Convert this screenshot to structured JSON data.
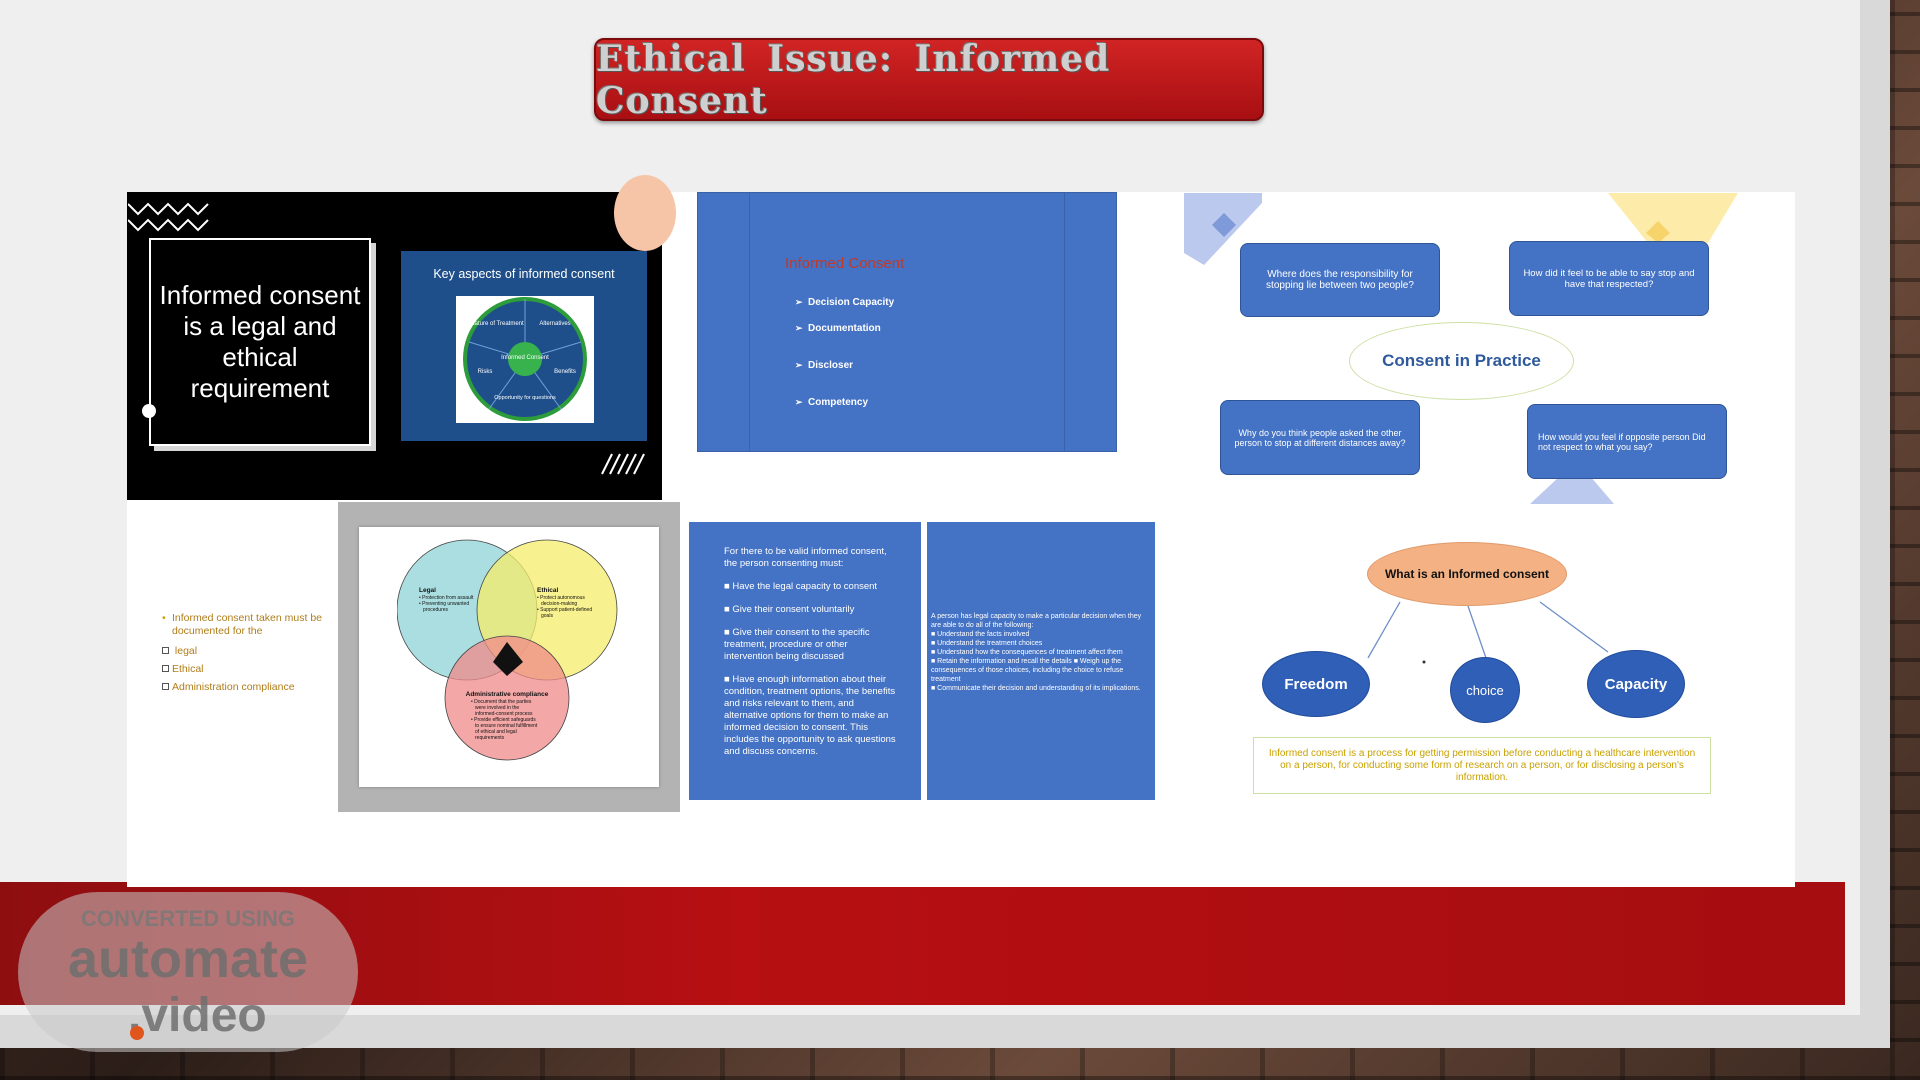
{
  "title": "Ethical Issue: Informed Consent",
  "panel_black": {
    "statement": "Informed consent is a legal and ethical requirement",
    "card_title": "Key aspects of informed consent",
    "wheel_center": "Informed Consent",
    "wheel_segments": [
      "Nature of Treatment",
      "Alternatives",
      "Benefits",
      "Opportunity for questions",
      "Risks"
    ]
  },
  "panel_blue": {
    "heading": "Informed Consent",
    "items": [
      "Decision Capacity",
      "Documentation",
      "Discloser",
      "Competency"
    ]
  },
  "bullets": {
    "lead": "Informed consent taken must be documented for the",
    "items": [
      "legal",
      "Ethical",
      "Administration compliance"
    ]
  },
  "venn": {
    "legal_title": "Legal",
    "legal_points": [
      "• Protection from assault",
      "• Preventing unwanted",
      "procedures"
    ],
    "ethical_title": "Ethical",
    "ethical_points": [
      "• Protect autonomous",
      "decision-making",
      "• Support patient-defined",
      "goals"
    ],
    "admin_title": "Administrative compliance",
    "admin_points": [
      "• Document that the parties",
      "were involved in the",
      "informed-consent process",
      "• Provide efficient safeguards",
      "to ensure nominal fulfillment",
      "of ethical and legal",
      "requirements"
    ]
  },
  "valid_consent": {
    "intro": "For there to be valid informed consent, the person consenting must:",
    "items": [
      "■ Have the legal capacity to consent",
      "■ Give their consent voluntarily",
      "■ Give their consent to the specific treatment, procedure or other intervention being discussed",
      "■ Have enough information about their condition, treatment options, the benefits and risks relevant to them, and alternative options for them to make an informed decision to consent. This includes the opportunity to ask questions and discuss concerns."
    ]
  },
  "capacity_text": {
    "intro": "A person has legal capacity to make a particular decision when they are able to do all of the following:",
    "items": [
      "■ Understand the facts involved",
      "■ Understand the treatment choices",
      "■ Understand how the consequences of treatment affect them",
      "■ Retain the information and recall the details ■ Weigh up the consequences of those choices, including the choice to refuse treatment",
      "■ Communicate their decision and understanding of its implications."
    ]
  },
  "consent_practice": {
    "center": "Consent in Practice",
    "q1": "Where does the responsibility for stopping lie between two people?",
    "q2": "How did it feel to be able to say stop and have that respected?",
    "q3": "Why do you think people asked the other person to stop at different distances away?",
    "q4": "How would you feel if opposite person Did not respect to what you say?"
  },
  "what_is": {
    "top": "What is an Informed consent",
    "nodes": [
      "Freedom",
      "choice",
      "Capacity"
    ],
    "definition": "Informed consent is a process for getting permission before conducting a healthcare intervention on a person, for conducting some form of research on a person, or for disclosing a person's information."
  },
  "watermark": {
    "line1": "CONVERTED USING",
    "line2": "automate",
    "line3": ".video"
  },
  "colors": {
    "title_red": "#b71c1c",
    "slide_blue": "#4472c4",
    "oval_blue": "#2f5fb7",
    "peach": "#f4b183",
    "gold_text": "#c8a100"
  }
}
